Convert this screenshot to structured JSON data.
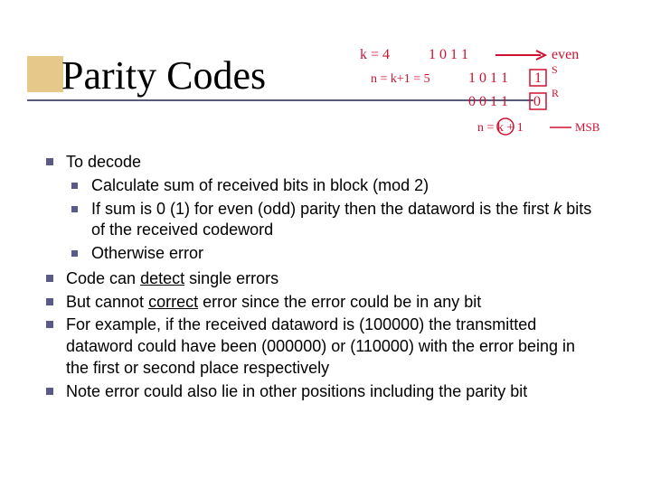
{
  "title": "Parity Codes",
  "bullets": [
    {
      "text": "To decode",
      "children": [
        {
          "text": "Calculate sum of received bits in block (mod 2)"
        },
        {
          "text_html": "If sum is 0 (1) for even (odd) parity then the dataword is the first <span class=\"ital\">k</span> bits of the received codeword"
        },
        {
          "text": "Otherwise error"
        }
      ]
    },
    {
      "text_html": "Code can <span class=\"u\">detect</span> single errors"
    },
    {
      "text_html": "But cannot <span class=\"u\">correct</span> error since the error could be in any bit"
    },
    {
      "text": "For example, if the received dataword is (100000) the transmitted dataword could have been (000000) or (110000) with the error being in the first or second place respectively"
    },
    {
      "text": "Note error could also lie in other positions including the parity bit"
    }
  ],
  "annotations": {
    "line1_left": "k = 4",
    "line1_bits": "1 0 1 1",
    "line1_right": "even",
    "line2_left": "n = k+1 = 5",
    "line2_bits": "1 0 1 1",
    "line2_box": "1",
    "line2_sup": "S",
    "line3_bits": "0 0 1 1",
    "line3_box": "0",
    "line3_sup": "R",
    "line4": "n = k + 1",
    "line4_tag": "MSB"
  }
}
